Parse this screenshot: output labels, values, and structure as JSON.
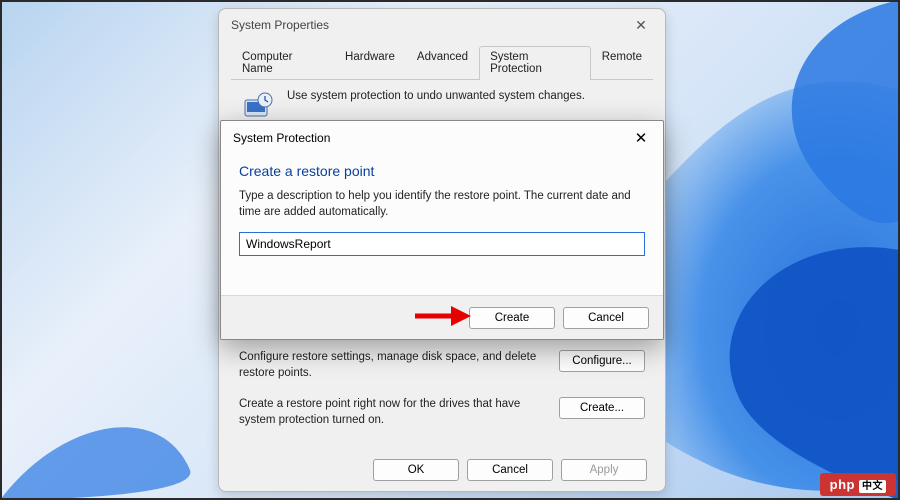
{
  "backWindow": {
    "title": "System Properties",
    "tabs": [
      "Computer Name",
      "Hardware",
      "Advanced",
      "System Protection",
      "Remote"
    ],
    "description": "Use system protection to undo unwanted system changes.",
    "configure": {
      "text": "Configure restore settings, manage disk space, and delete restore points.",
      "button": "Configure..."
    },
    "create": {
      "text": "Create a restore point right now for the drives that have system protection turned on.",
      "button": "Create..."
    },
    "buttons": {
      "ok": "OK",
      "cancel": "Cancel",
      "apply": "Apply"
    }
  },
  "frontDialog": {
    "title": "System Protection",
    "heading": "Create a restore point",
    "text": "Type a description to help you identify the restore point. The current date and time are added automatically.",
    "inputValue": "WindowsReport",
    "buttons": {
      "create": "Create",
      "cancel": "Cancel"
    }
  },
  "watermark": {
    "text": "php",
    "cn": "中文"
  }
}
